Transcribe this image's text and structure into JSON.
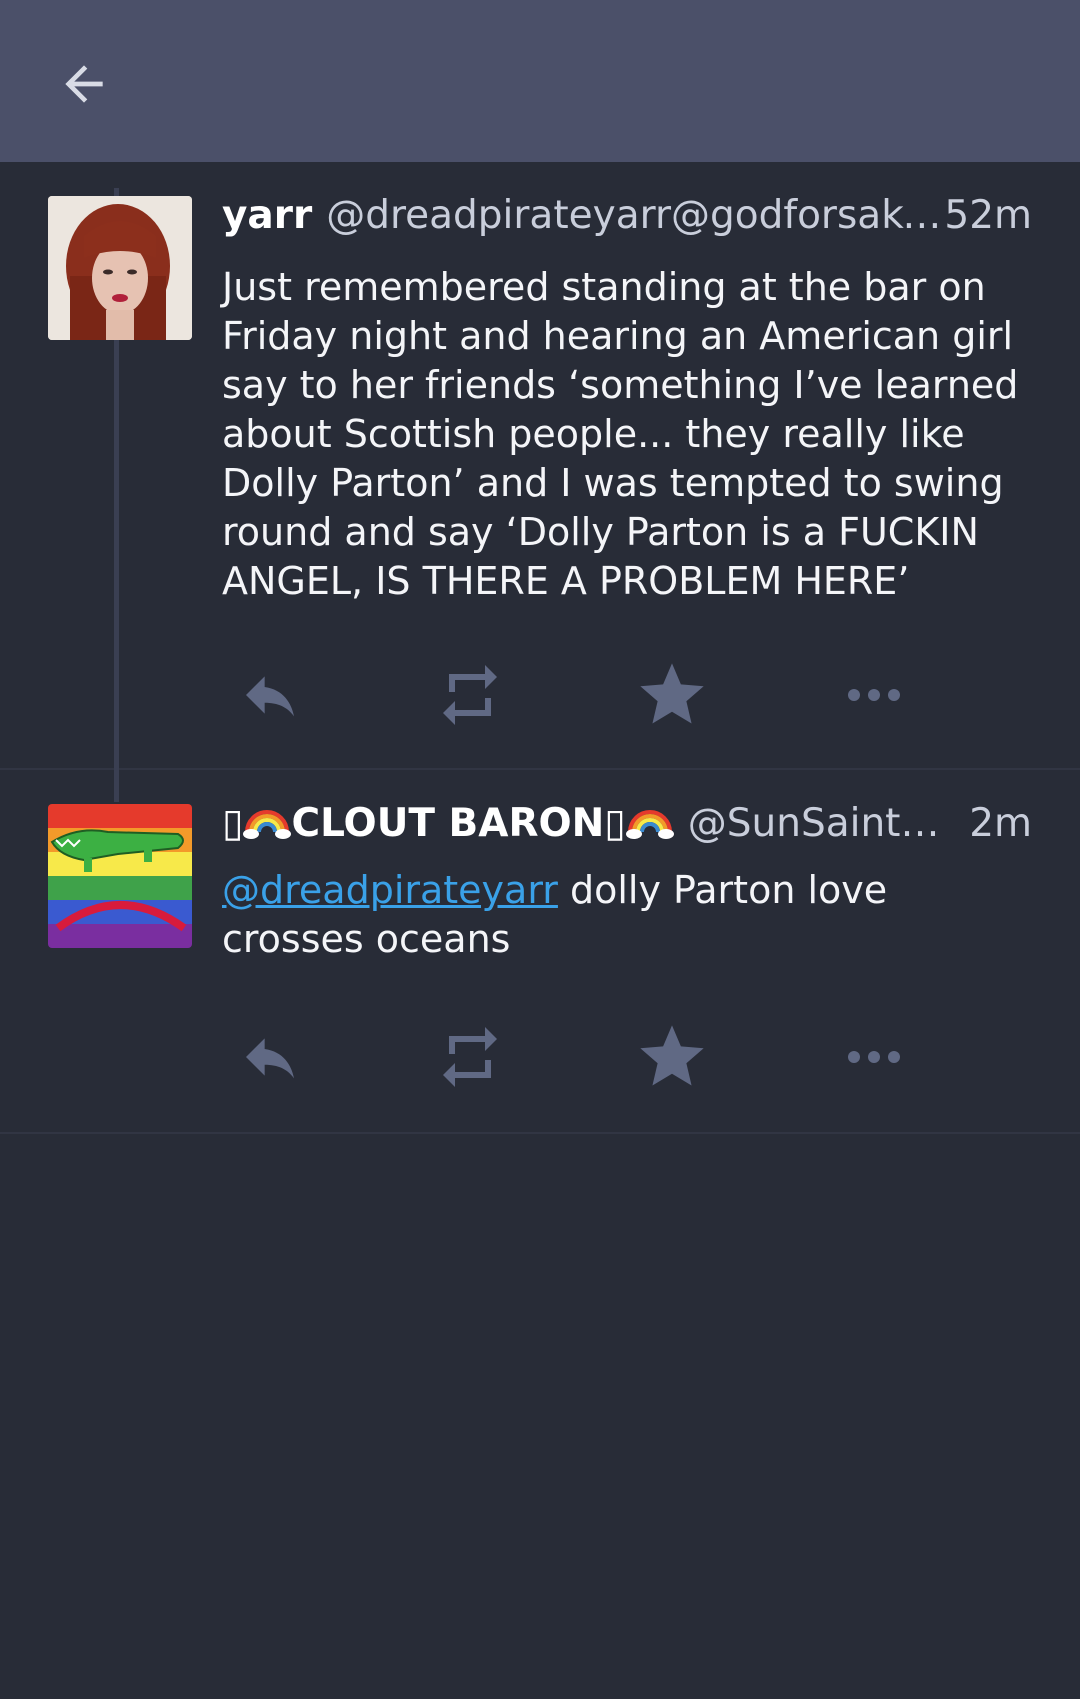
{
  "header_bar": {
    "back_icon": "arrow-left-icon"
  },
  "statuses": [
    {
      "display_name": "yarr",
      "acct": "@dreadpirateyarr@godforsaken.website",
      "time": "52m",
      "content": "Just remembered standing at the bar on Friday night and hearing an American girl say to her friends ‘something I’ve learned about Scottish people... they really like Dolly Parton’ and I was tempted to swing round and say ‘Dolly Parton is a FUCKIN ANGEL, IS THERE A PROBLEM HERE’"
    },
    {
      "display_name_pre": "▯",
      "display_name_text": "CLOUT BARON",
      "display_name_mid": "▯",
      "acct": "@SunSaint@witches.town",
      "time": "2m",
      "mention": "@dreadpirateyarr",
      "content": " dolly Parton love crosses oceans"
    }
  ],
  "actions": {
    "icons": [
      "reply-icon",
      "boost-icon",
      "favourite-icon",
      "more-icon"
    ]
  },
  "colors": {
    "background": "#282c37",
    "topbar": "#4b5069",
    "icon": "#606984",
    "link": "#3aa1e8"
  }
}
